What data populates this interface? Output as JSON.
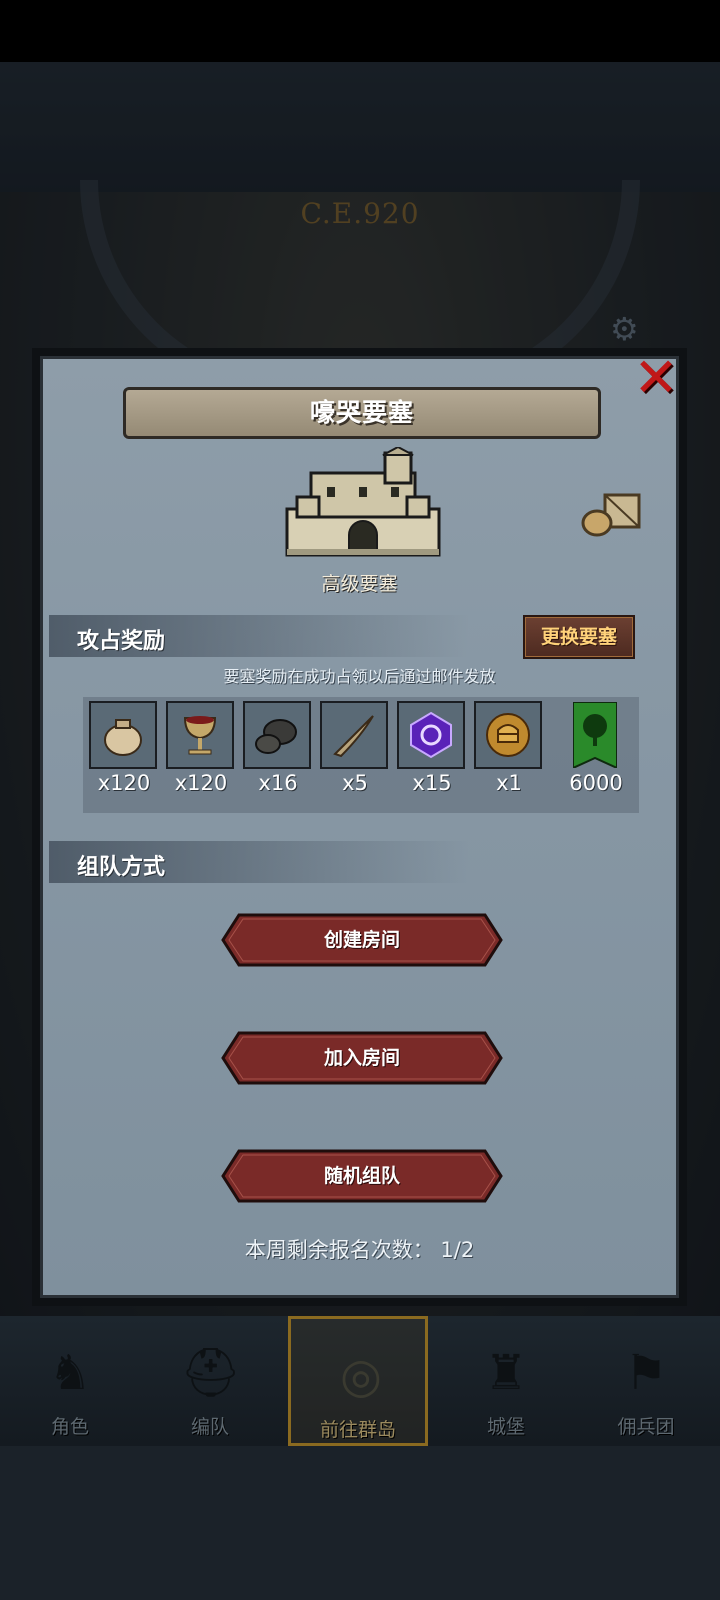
{
  "header": {
    "era": "C.E.920"
  },
  "dialog": {
    "title": "嚎哭要塞",
    "fortress_grade": "高级要塞",
    "rewards_section": {
      "label": "攻占奖励",
      "change_button": "更换要塞",
      "note": "要塞奖励在成功占领以后通过邮件发放",
      "items": [
        {
          "icon": "pouch-icon",
          "qty": "x120"
        },
        {
          "icon": "goblet-icon",
          "qty": "x120"
        },
        {
          "icon": "ore-icon",
          "qty": "x16"
        },
        {
          "icon": "horn-icon",
          "qty": "x5"
        },
        {
          "icon": "purple-rune-icon",
          "qty": "x15"
        },
        {
          "icon": "knight-helmet-coin-icon",
          "qty": "x1"
        },
        {
          "icon": "tree-banner-icon",
          "qty": "6000"
        }
      ]
    },
    "team_section": {
      "label": "组队方式",
      "buttons": [
        "创建房间",
        "加入房间",
        "随机组队"
      ]
    },
    "remaining": "本周剩余报名次数： 1/2"
  },
  "bottom_nav": {
    "items": [
      {
        "label": "角色",
        "icon": "knight-icon"
      },
      {
        "label": "编队",
        "icon": "helmet-icon"
      },
      {
        "label": "前往群岛",
        "icon": "compass-icon",
        "active": true
      },
      {
        "label": "城堡",
        "icon": "castle-icon"
      },
      {
        "label": "佣兵团",
        "icon": "banner-icon"
      }
    ]
  },
  "colors": {
    "panel": "#8797a4",
    "button_red": "#7a2a28",
    "accent_gold": "#ffd27a",
    "close_red": "#c01818"
  }
}
